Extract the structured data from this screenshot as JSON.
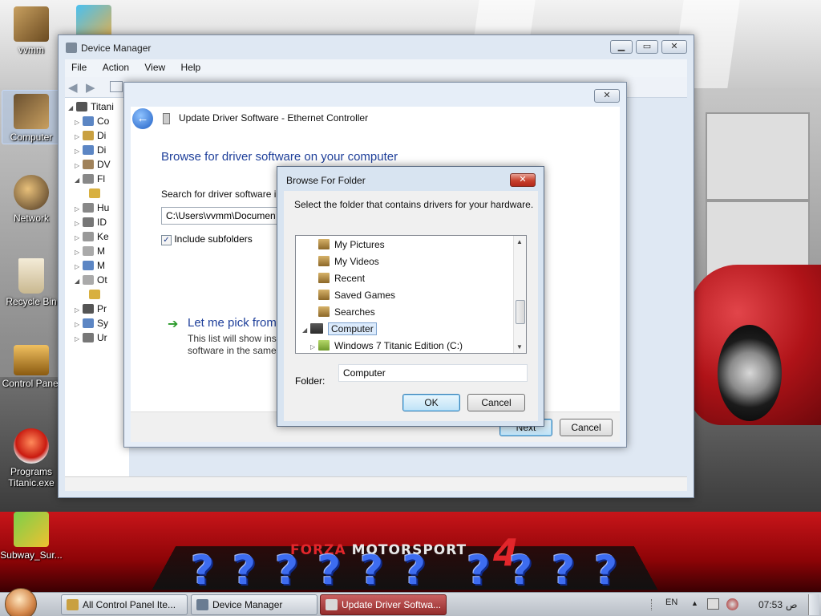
{
  "desktop": {
    "icons": [
      {
        "label": "vvmm"
      },
      {
        "label": ""
      },
      {
        "label": "Computer"
      },
      {
        "label": "Network"
      },
      {
        "label": "Recycle Bin"
      },
      {
        "label": "Control Panel"
      },
      {
        "label": "Programs Titanic.exe"
      },
      {
        "label": "Subway_Sur..."
      }
    ]
  },
  "banner": {
    "brand_red": "FORZA",
    "brand_white": "MOTORSPORT",
    "number": "4",
    "qmark": "?"
  },
  "device_manager": {
    "title": "Device Manager",
    "menu": [
      "File",
      "Action",
      "View",
      "Help"
    ],
    "tree_root": "Titani",
    "tree": [
      "Co",
      "Di",
      "Di",
      "DV",
      "Fl",
      "",
      "Hu",
      "ID",
      "Ke",
      "M",
      "M",
      "Ot",
      "",
      "Pr",
      "Sy",
      "Ur"
    ]
  },
  "update_driver": {
    "title": "Update Driver Software - Ethernet Controller",
    "heading": "Browse for driver software on your computer",
    "search_label": "Search for driver software in",
    "path": "C:\\Users\\vvmm\\Documen",
    "include_subfolders": "Include subfolders",
    "pick_title": "Let me pick from",
    "pick_desc": "This list will show inst software in the same",
    "next": "Next",
    "cancel": "Cancel"
  },
  "browse_folder": {
    "title": "Browse For Folder",
    "description": "Select the folder that contains drivers for your hardware.",
    "items": [
      {
        "label": "My Pictures",
        "kind": "folder"
      },
      {
        "label": "My Videos",
        "kind": "folder"
      },
      {
        "label": "Recent",
        "kind": "folder"
      },
      {
        "label": "Saved Games",
        "kind": "folder"
      },
      {
        "label": "Searches",
        "kind": "folder"
      },
      {
        "label": "Computer",
        "kind": "computer"
      },
      {
        "label": "Windows 7 Titanic Edition (C:)",
        "kind": "drive"
      }
    ],
    "folder_label": "Folder:",
    "folder_value": "Computer",
    "ok": "OK",
    "cancel": "Cancel"
  },
  "taskbar": {
    "buttons": [
      "All Control Panel Ite...",
      "Device Manager",
      "Update Driver Softwa..."
    ],
    "lang": "EN",
    "time": "07:53",
    "ampm": "ص"
  },
  "colors": {
    "accent": "#1e3f9a",
    "close_red": "#c7402c",
    "banner_red": "#c8151a"
  }
}
